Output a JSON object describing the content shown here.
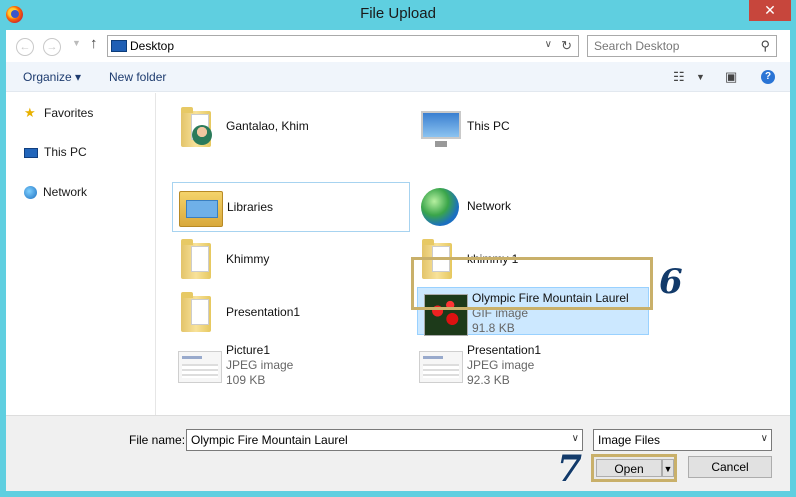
{
  "window": {
    "title": "File Upload",
    "close_glyph": "✕"
  },
  "address": {
    "location": "Desktop",
    "search_placeholder": "Search Desktop"
  },
  "toolbar": {
    "organize": "Organize ▾",
    "new_folder": "New folder",
    "help": "?"
  },
  "nav": [
    {
      "label": "Favorites",
      "icon": "star-icon"
    },
    {
      "label": "This PC",
      "icon": "computer-icon"
    },
    {
      "label": "Network",
      "icon": "network-icon"
    }
  ],
  "files": [
    {
      "name": "Gantalao, Khim",
      "icon": "user-folder-icon"
    },
    {
      "name": "This PC",
      "icon": "computer-icon"
    },
    {
      "name": "Libraries",
      "icon": "libraries-icon"
    },
    {
      "name": "Network",
      "icon": "network-icon"
    },
    {
      "name": "Khimmy",
      "icon": "folder-icon"
    },
    {
      "name": "khimmy 1",
      "icon": "folder-icon"
    },
    {
      "name": "Presentation1",
      "icon": "folder-icon"
    },
    {
      "name": "Olympic Fire Mountain Laurel",
      "type": "GIF image",
      "size": "91.8 KB",
      "icon": "image-thumbnail"
    },
    {
      "name": "Picture1",
      "type": "JPEG image",
      "size": "109 KB",
      "icon": "image-thumbnail"
    },
    {
      "name": "Presentation1",
      "type": "JPEG image",
      "size": "92.3 KB",
      "icon": "image-thumbnail"
    }
  ],
  "bottom": {
    "file_name_label": "File name:",
    "file_name_value": "Olympic Fire Mountain Laurel",
    "file_type_value": "Image Files",
    "open_label": "Open",
    "cancel_label": "Cancel"
  },
  "callouts": {
    "step6": "6",
    "step7": "7"
  },
  "colors": {
    "titlebar": "#5fcfe0",
    "selection": "#cce8ff",
    "callout_border": "#c9b06a"
  }
}
